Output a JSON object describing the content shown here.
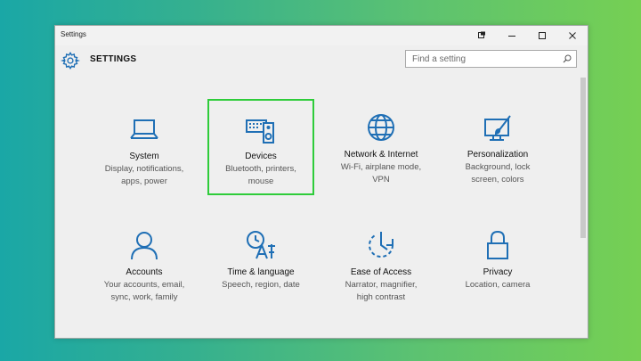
{
  "window": {
    "title": "Settings",
    "pin_glyph": "pin-icon",
    "minimize_glyph": "—",
    "maximize_glyph": "☐",
    "close_glyph": "✕"
  },
  "header": {
    "title": "SETTINGS",
    "search_placeholder": "Find a setting"
  },
  "colors": {
    "accent": "#1f6fb5",
    "selection": "#2ecc3a",
    "window_bg": "#efefef"
  },
  "tiles": [
    {
      "name": "System",
      "desc1": "Display, notifications,",
      "desc2": "apps, power",
      "icon": "laptop-icon"
    },
    {
      "name": "Devices",
      "desc1": "Bluetooth, printers,",
      "desc2": "mouse",
      "icon": "devices-icon",
      "selected": true
    },
    {
      "name": "Network & Internet",
      "desc1": "Wi-Fi, airplane mode,",
      "desc2": "VPN",
      "icon": "globe-icon"
    },
    {
      "name": "Personalization",
      "desc1": "Background, lock",
      "desc2": "screen, colors",
      "icon": "personalization-icon"
    },
    {
      "name": "Accounts",
      "desc1": "Your accounts, email,",
      "desc2": "sync, work, family",
      "icon": "person-icon"
    },
    {
      "name": "Time & language",
      "desc1": "Speech, region, date",
      "desc2": "",
      "icon": "time-language-icon"
    },
    {
      "name": "Ease of Access",
      "desc1": "Narrator, magnifier,",
      "desc2": "high contrast",
      "icon": "ease-of-access-icon"
    },
    {
      "name": "Privacy",
      "desc1": "Location, camera",
      "desc2": "",
      "icon": "lock-icon"
    }
  ]
}
